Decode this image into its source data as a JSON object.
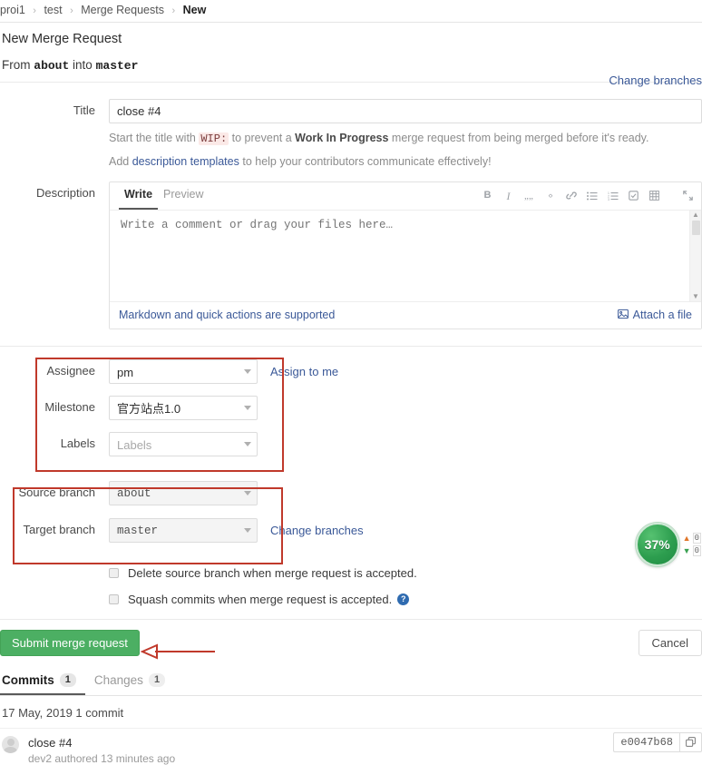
{
  "breadcrumb": {
    "items": [
      {
        "label": "proi1"
      },
      {
        "label": "test"
      },
      {
        "label": "Merge Requests"
      },
      {
        "label": "New"
      }
    ],
    "separator": "›"
  },
  "header": {
    "title": "New Merge Request",
    "from_word": "From",
    "source_branch": "about",
    "into_word": "into",
    "target_branch": "master",
    "change_branches_label": "Change branches"
  },
  "form": {
    "title_label": "Title",
    "title_value": "close #4",
    "title_placeholder": "Title",
    "hint1_a": "Start the title with",
    "hint1_code": "WIP:",
    "hint1_b": "to prevent a",
    "hint1_bold": "Work In Progress",
    "hint1_c": "merge request from being merged before it's ready.",
    "hint2_a": "Add",
    "hint2_link": "description templates",
    "hint2_b": "to help your contributors communicate effectively!",
    "description_label": "Description",
    "editor": {
      "tabs": [
        {
          "label": "Write",
          "active": true
        },
        {
          "label": "Preview",
          "active": false
        }
      ],
      "textarea_placeholder": "Write a comment or drag your files here…",
      "textarea_value": "",
      "tools": [
        {
          "name": "bold-icon",
          "glyph": "B"
        },
        {
          "name": "italic-icon",
          "glyph": "I"
        },
        {
          "name": "quote-icon",
          "glyph": "”"
        },
        {
          "name": "code-icon",
          "glyph": "‹›"
        },
        {
          "name": "link-icon",
          "glyph": "⚭"
        },
        {
          "name": "bullet-list-icon",
          "glyph": "≡"
        },
        {
          "name": "numbered-list-icon",
          "glyph": "≣"
        },
        {
          "name": "task-list-icon",
          "glyph": "☑"
        },
        {
          "name": "table-icon",
          "glyph": "▦"
        },
        {
          "name": "fullscreen-icon",
          "glyph": "⛶"
        }
      ],
      "footer_hint": "Markdown and quick actions are supported",
      "attach_label": "Attach a file",
      "attach_icon": "image-icon"
    }
  },
  "meta": {
    "assignee_label": "Assignee",
    "assignee_value": "pm",
    "assign_to_me_label": "Assign to me",
    "milestone_label": "Milestone",
    "milestone_value": "官方站点1.0",
    "labels_label": "Labels",
    "labels_placeholder": "Labels"
  },
  "branches": {
    "source_label": "Source branch",
    "source_value": "about",
    "target_label": "Target branch",
    "target_value": "master",
    "change_branches_label": "Change branches"
  },
  "options": {
    "delete_source": {
      "label": "Delete source branch when merge request is accepted.",
      "checked": false
    },
    "squash_commits": {
      "label": "Squash commits when merge request is accepted.",
      "checked": false,
      "help_icon": "question-mark-icon",
      "help_glyph": "?"
    }
  },
  "actions": {
    "submit_label": "Submit merge request",
    "cancel_label": "Cancel",
    "submit_color": "#4caf63"
  },
  "bottom_tabs": [
    {
      "label": "Commits",
      "count": "1",
      "active": true
    },
    {
      "label": "Changes",
      "count": "1",
      "active": false
    }
  ],
  "commits": {
    "date_line": "17 May, 2019 1 commit",
    "items": [
      {
        "title": "close #4",
        "subtitle": "dev2 authored 13 minutes ago",
        "sha": "e0047b68",
        "copy_icon": "copy-icon",
        "avatar": "avatar"
      }
    ]
  },
  "overlay_widget": {
    "percent": "37%",
    "up_value": "0",
    "down_value": "0",
    "up_icon": "arrow-up-icon",
    "down_icon": "arrow-down-icon",
    "color": "#2d9e4f"
  },
  "annotations": {
    "color": "#c0392b",
    "boxes": [
      {
        "name": "annotation-box-meta"
      },
      {
        "name": "annotation-box-branches"
      }
    ],
    "arrow": {
      "name": "annotation-arrow-submit"
    }
  }
}
